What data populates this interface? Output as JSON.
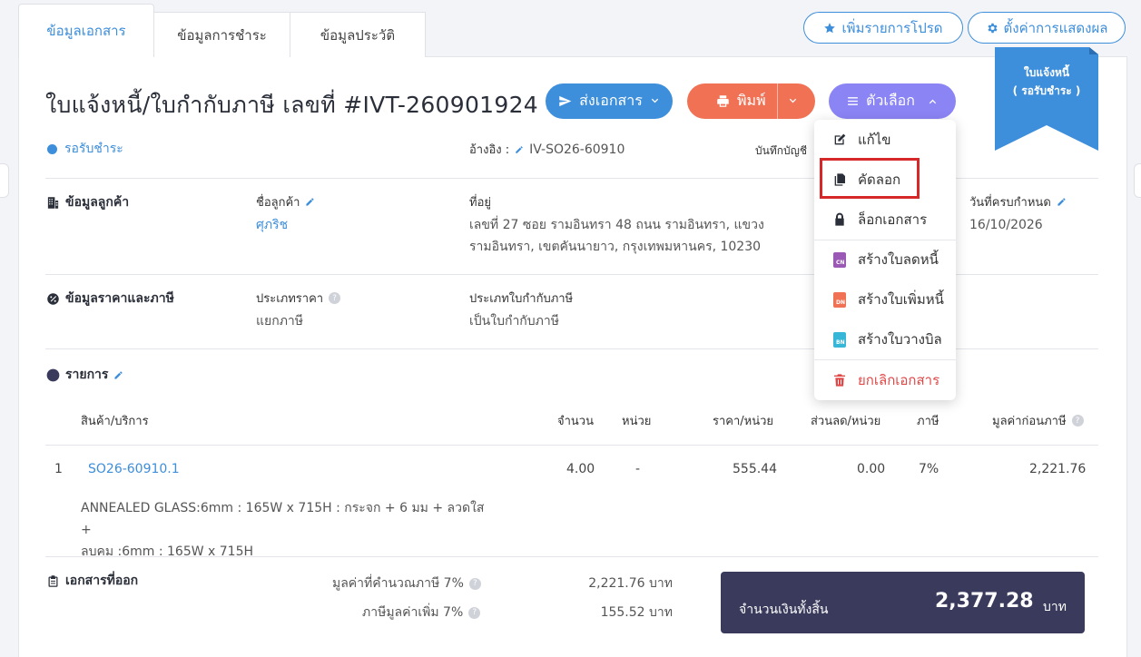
{
  "tabs": [
    {
      "label": "ข้อมูลเอกสาร",
      "active": true
    },
    {
      "label": "ข้อมูลการชำระ",
      "active": false
    },
    {
      "label": "ข้อมูลประวัติ",
      "active": false
    }
  ],
  "top_actions": {
    "favorite_label": "เพิ่มรายการโปรด",
    "settings_label": "ตั้งค่าการแสดงผล"
  },
  "document": {
    "title": "ใบแจ้งหนี้/ใบกำกับภาษี เลขที่ #IVT-260901924",
    "status": "รอรับชำระ",
    "reference_label": "อ้างอิง :",
    "reference_value": "IV-SO26-60910",
    "record_label": "บันทึกบัญชี"
  },
  "ribbon": {
    "line1": "ใบแจ้งหนี้",
    "line2": "( รอรับชำระ )",
    "color": "#3d8edb"
  },
  "actions": {
    "send_label": "ส่งเอกสาร",
    "print_label": "พิมพ์",
    "options_label": "ตัวเลือก"
  },
  "options_menu": {
    "items": [
      {
        "label": "แก้ไข",
        "icon": "edit-icon"
      },
      {
        "label": "คัดลอก",
        "icon": "copy-icon",
        "highlighted": true
      },
      {
        "label": "ล็อกเอกสาร",
        "icon": "lock-icon"
      },
      {
        "label": "สร้างใบลดหนี้",
        "icon": "credit-note-icon",
        "badge": "CN"
      },
      {
        "label": "สร้างใบเพิ่มหนี้",
        "icon": "debit-note-icon",
        "badge": "DN"
      },
      {
        "label": "สร้างใบวางบิล",
        "icon": "billing-note-icon",
        "badge": "BN"
      },
      {
        "label": "ยกเลิกเอกสาร",
        "icon": "trash-icon"
      }
    ]
  },
  "customer": {
    "section_title": "ข้อมูลลูกค้า",
    "name_label": "ชื่อลูกค้า",
    "name_value": "ศุภริช",
    "address_label": "ที่อยู่",
    "address_line1": "เลขที่ 27 ซอย รามอินทรา 48 ถนน รามอินทรา, แขวง",
    "address_line2": "รามอินทรา, เขตคันนายาว, กรุงเทพมหานคร, 10230",
    "due_label": "วันที่ครบกำหนด",
    "due_value": "16/10/2026"
  },
  "pricing": {
    "section_title": "ข้อมูลราคาและภาษี",
    "price_type_label": "ประเภทราคา",
    "price_type_value": "แยกภาษี",
    "tax_doc_label": "ประเภทใบกำกับภาษี",
    "tax_doc_value": "เป็นใบกำกับภาษี"
  },
  "items": {
    "section_title": "รายการ",
    "headers": {
      "product": "สินค้า/บริการ",
      "qty": "จำนวน",
      "unit": "หน่วย",
      "price": "ราคา/หน่วย",
      "discount": "ส่วนลด/หน่วย",
      "tax": "ภาษี",
      "pretax": "มูลค่าก่อนภาษี"
    },
    "rows": [
      {
        "no": "1",
        "code": "SO26-60910.1",
        "qty": "4.00",
        "unit": "-",
        "price": "555.44",
        "discount": "0.00",
        "tax": "7%",
        "pretax": "2,221.76",
        "desc_line1": "ANNEALED GLASS:6mm : 165W x 715H : กระจก + 6 มม + ลวดใส +",
        "desc_line2": "ลบคม :6mm : 165W x 715H"
      }
    ]
  },
  "summary": {
    "issued_docs_title": "เอกสารที่ออก",
    "taxable_label": "มูลค่าที่คำนวณภาษี 7%",
    "taxable_value": "2,221.76 บาท",
    "vat_label": "ภาษีมูลค่าเพิ่ม 7%",
    "vat_value": "155.52 บาท",
    "total_label": "จำนวนเงินทั้งสิ้น",
    "total_value": "2,377.28",
    "total_unit": "บาท"
  }
}
